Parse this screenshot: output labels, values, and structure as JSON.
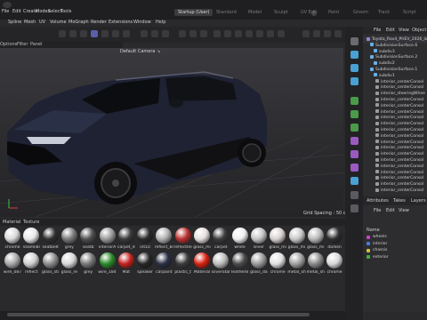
{
  "menu": [
    "File",
    "Edit",
    "Create",
    "Modes",
    "Select",
    "Tools",
    "Spline",
    "Mesh",
    "UV",
    "Volume",
    "MoGraph",
    "Render",
    "Extensions",
    "Window",
    "Help"
  ],
  "layout_tabs": [
    "Startup (User)",
    "Standard",
    "Model",
    "Sculpt",
    "UV Edit",
    "Paint",
    "Groom",
    "Track",
    "Script",
    "Nodes"
  ],
  "subbar": [
    "Options",
    "Filter",
    "Panel"
  ],
  "viewport": {
    "camera": "Default Camera ↘",
    "grid": "Grid Spacing : 50 cm"
  },
  "object_manager": {
    "menu": [
      "File",
      "Edit",
      "View",
      "Object"
    ],
    "rows": [
      {
        "label": "Toyota_Rav4_PHEV_2026_lowp",
        "color": "#8a8ad0"
      },
      {
        "label": "SubdivisionSurface.6",
        "color": "#6ab0e6"
      },
      {
        "label": "subdiv3",
        "color": "#6ab0e6"
      },
      {
        "label": "SubdivisionSurface.2",
        "color": "#6ab0e6"
      },
      {
        "label": "subdiv2",
        "color": "#6ab0e6"
      },
      {
        "label": "SubdivisionSurface.1",
        "color": "#6ab0e6"
      },
      {
        "label": "subdiv1",
        "color": "#6ab0e6"
      },
      {
        "label": "interior_centerConsol",
        "color": "#9a9a9a"
      },
      {
        "label": "interior_centerConsol",
        "color": "#9a9a9a"
      },
      {
        "label": "interior_steeringWhee",
        "color": "#9a9a9a"
      },
      {
        "label": "interior_centerConsol",
        "color": "#9a9a9a"
      },
      {
        "label": "interior_centerConsol",
        "color": "#9a9a9a"
      },
      {
        "label": "interior_centerConsol",
        "color": "#9a9a9a"
      },
      {
        "label": "interior_centerConsol",
        "color": "#9a9a9a"
      },
      {
        "label": "interior_centerConsol",
        "color": "#9a9a9a"
      },
      {
        "label": "interior_centerConsol",
        "color": "#9a9a9a"
      },
      {
        "label": "interior_centerConsol",
        "color": "#9a9a9a"
      },
      {
        "label": "interior_centerConsol",
        "color": "#9a9a9a"
      },
      {
        "label": "interior_centerConsol",
        "color": "#9a9a9a"
      },
      {
        "label": "interior_centerConsol",
        "color": "#9a9a9a"
      },
      {
        "label": "interior_centerConsol",
        "color": "#9a9a9a"
      },
      {
        "label": "interior_centerConsol",
        "color": "#9a9a9a"
      },
      {
        "label": "interior_centerConsol",
        "color": "#9a9a9a"
      },
      {
        "label": "interior_centerConsol",
        "color": "#9a9a9a"
      },
      {
        "label": "interior_centerConsol",
        "color": "#9a9a9a"
      },
      {
        "label": "interior_centerConsol",
        "color": "#9a9a9a"
      }
    ]
  },
  "attr_tabs": [
    "Attributes",
    "Takes",
    "Layers"
  ],
  "layers": {
    "menu": [
      "File",
      "Edit",
      "View"
    ],
    "header": "Name",
    "items": [
      {
        "label": "wheels",
        "color": "#c842c8"
      },
      {
        "label": "interior",
        "color": "#4a7ae0"
      },
      {
        "label": "chassis",
        "color": "#d0c040"
      },
      {
        "label": "exterior",
        "color": "#40b040"
      }
    ]
  },
  "material_manager": {
    "menu": [
      "Material",
      "Texture"
    ],
    "row1": [
      {
        "label": "chrome",
        "color": "#d8d8d8"
      },
      {
        "label": "seamlibl",
        "color": "#e8e8e8"
      },
      {
        "label": "seatbelt",
        "color": "#303030"
      },
      {
        "label": "grey",
        "color": "#7a7a7a"
      },
      {
        "label": "seatb",
        "color": "#505050"
      },
      {
        "label": "interiorA",
        "color": "#9a9a9a"
      },
      {
        "label": "carpet_d",
        "color": "#3a3a3a"
      },
      {
        "label": "int10",
        "color": "#2a2a2a"
      },
      {
        "label": "reflect_Bl",
        "color": "#b0b0b0"
      },
      {
        "label": "reflectRe",
        "color": "#b83030"
      },
      {
        "label": "glass_mi",
        "color": "#e6dede"
      },
      {
        "label": "carpet",
        "color": "#3c3c3c"
      },
      {
        "label": "white",
        "color": "#efefef"
      },
      {
        "label": "silver",
        "color": "#c4c4c4"
      },
      {
        "label": "glass_mi",
        "color": "#d7d0d0"
      },
      {
        "label": "glass_mi",
        "color": "#c8c8c8"
      },
      {
        "label": "glass_mi",
        "color": "#b8b8b8"
      },
      {
        "label": "darken",
        "color": "#2e2e2e"
      }
    ],
    "row2": [
      {
        "label": "wire_087",
        "color": "#a8a8a8"
      },
      {
        "label": "reflect",
        "color": "#d0d0d0"
      },
      {
        "label": "glass_sti",
        "color": "#8c8c8c"
      },
      {
        "label": "glass_re",
        "color": "#d7d7d7"
      },
      {
        "label": "grey",
        "color": "#777777"
      },
      {
        "label": "wire_184",
        "color": "#2a8a2a"
      },
      {
        "label": "Mat",
        "color": "#c42020"
      },
      {
        "label": "speaker",
        "color": "#262626"
      },
      {
        "label": "carpaint",
        "color": "#2a2f44"
      },
      {
        "label": "plastic_t",
        "color": "#3a3a3a"
      },
      {
        "label": "Material",
        "color": "#d82010"
      },
      {
        "label": "silverStar",
        "color": "#bcbcbc"
      },
      {
        "label": "leatherB",
        "color": "#4a4a4a"
      },
      {
        "label": "glass_da",
        "color": "#9a9a9a"
      },
      {
        "label": "chrome",
        "color": "#e0e0e0"
      },
      {
        "label": "metal_sh",
        "color": "#a0a0a0"
      },
      {
        "label": "metal_sh",
        "color": "#8a8a8a"
      },
      {
        "label": "chrome",
        "color": "#d8d8d8"
      }
    ]
  }
}
